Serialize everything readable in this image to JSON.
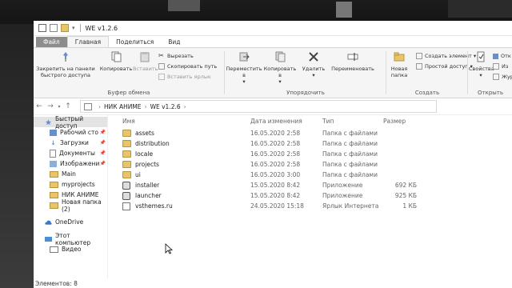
{
  "window": {
    "title": "WE v1.2.6"
  },
  "ribbon_tabs": [
    "Файл",
    "Главная",
    "Поделиться",
    "Вид"
  ],
  "ribbon": {
    "clipboard": {
      "pin_label": "Закрепить на панели быстрого доступа",
      "copy_label": "Копировать",
      "paste_label": "Вставить",
      "cut_label": "Вырезать",
      "copy_path_label": "Скопировать путь",
      "paste_shortcut_label": "Вставить ярлык",
      "group_label": "Буфер обмена"
    },
    "organize": {
      "move_to_label": "Переместить в",
      "copy_to_label": "Копировать в",
      "delete_label": "Удалить",
      "rename_label": "Переименовать",
      "group_label": "Упорядочить"
    },
    "create": {
      "new_folder_label": "Новая папка",
      "new_item_label": "Создать элемент",
      "easy_access_label": "Простой доступ",
      "group_label": "Создать"
    },
    "open": {
      "properties_label": "Свойства",
      "open_label": "Отк",
      "edit_label": "Из",
      "history_label": "Жур",
      "group_label": "Открыть"
    }
  },
  "address": {
    "crumbs": [
      "НИК АНИМЕ",
      "WE v1.2.6"
    ]
  },
  "nav_pane": {
    "items": [
      {
        "label": "Быстрый доступ",
        "icon": "star-icon",
        "selected": true,
        "pinned": false
      },
      {
        "label": "Рабочий сто",
        "icon": "desktop-icon",
        "pinned": true
      },
      {
        "label": "Загрузки",
        "icon": "download-icon",
        "pinned": true
      },
      {
        "label": "Документы",
        "icon": "documents-icon",
        "pinned": true
      },
      {
        "label": "Изображени",
        "icon": "pictures-icon",
        "pinned": true
      },
      {
        "label": "Main",
        "icon": "folder-icon",
        "pinned": false
      },
      {
        "label": "myprojects",
        "icon": "folder-icon",
        "pinned": false
      },
      {
        "label": "НИК АНИМЕ",
        "icon": "folder-icon",
        "pinned": false
      },
      {
        "label": "Новая папка (2)",
        "icon": "folder-icon",
        "pinned": false
      }
    ],
    "onedrive": {
      "label": "OneDrive",
      "icon": "cloud-icon"
    },
    "this_pc": {
      "label": "Этот компьютер",
      "icon": "computer-icon"
    },
    "video": {
      "label": "Видео",
      "icon": "video-icon"
    }
  },
  "columns": {
    "name": "Имя",
    "date": "Дата изменения",
    "type": "Тип",
    "size": "Размер"
  },
  "files": [
    {
      "name": "assets",
      "date": "16.05.2020 2:58",
      "type": "Папка с файлами",
      "size": "",
      "icon": "folder-icon"
    },
    {
      "name": "distribution",
      "date": "16.05.2020 2:58",
      "type": "Папка с файлами",
      "size": "",
      "icon": "folder-icon"
    },
    {
      "name": "locale",
      "date": "16.05.2020 2:58",
      "type": "Папка с файлами",
      "size": "",
      "icon": "folder-icon"
    },
    {
      "name": "projects",
      "date": "16.05.2020 2:58",
      "type": "Папка с файлами",
      "size": "",
      "icon": "folder-icon"
    },
    {
      "name": "ui",
      "date": "16.05.2020 3:00",
      "type": "Папка с файлами",
      "size": "",
      "icon": "folder-icon"
    },
    {
      "name": "installer",
      "date": "15.05.2020 8:42",
      "type": "Приложение",
      "size": "692 КБ",
      "icon": "app-icon"
    },
    {
      "name": "launcher",
      "date": "15.05.2020 8:42",
      "type": "Приложение",
      "size": "925 КБ",
      "icon": "app-icon"
    },
    {
      "name": "vsthemes.ru",
      "date": "24.05.2020 15:18",
      "type": "Ярлык Интернета",
      "size": "1 КБ",
      "icon": "link-icon"
    }
  ],
  "status_bar": {
    "items_count": "Элементов: 8"
  }
}
